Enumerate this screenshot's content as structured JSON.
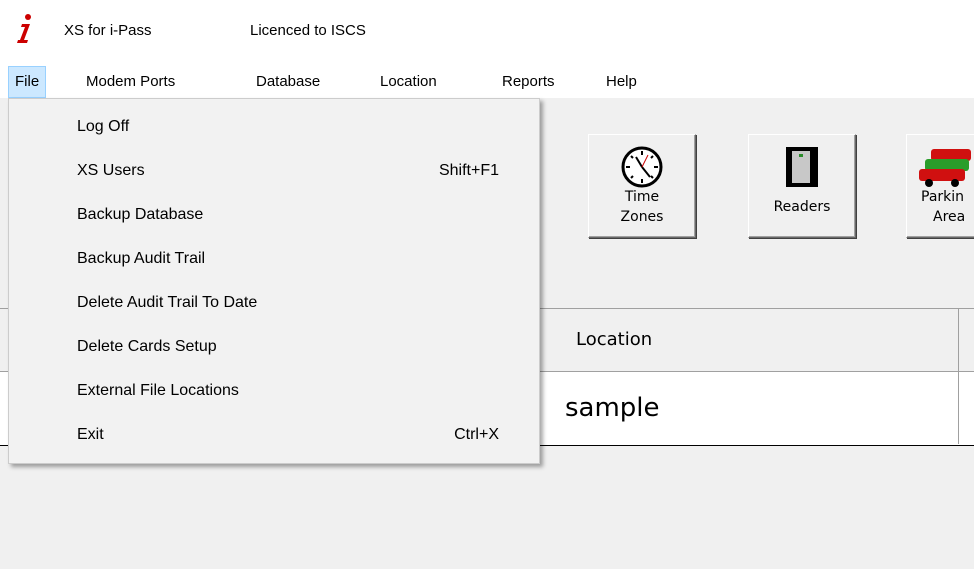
{
  "titlebar": {
    "app_name": "XS for i-Pass",
    "licence": "Licenced to ISCS",
    "icon": "italic-i-logo",
    "icon_color": "#cc0000"
  },
  "menubar": {
    "items": [
      {
        "label": "File"
      },
      {
        "label": "Modem Ports"
      },
      {
        "label": "Database"
      },
      {
        "label": "Location"
      },
      {
        "label": "Reports"
      },
      {
        "label": "Help"
      }
    ]
  },
  "file_menu": {
    "items": [
      {
        "label": "Log Off",
        "shortcut": ""
      },
      {
        "label": "XS Users",
        "shortcut": "Shift+F1"
      },
      {
        "label": "Backup Database",
        "shortcut": ""
      },
      {
        "label": "Backup Audit Trail",
        "shortcut": ""
      },
      {
        "label": "Delete Audit Trail To Date",
        "shortcut": ""
      },
      {
        "label": "Delete Cards Setup",
        "shortcut": ""
      },
      {
        "label": "External File Locations",
        "shortcut": ""
      },
      {
        "label": "Exit",
        "shortcut": "Ctrl+X"
      }
    ]
  },
  "toolbar": {
    "time_zones": {
      "label_line1": "Time",
      "label_line2": "Zones",
      "icon": "clock-icon"
    },
    "readers": {
      "label": "Readers",
      "icon": "reader-icon"
    },
    "parking": {
      "label_line1": "Parkin",
      "label_line2": "Area",
      "icon": "cars-icon"
    }
  },
  "grid": {
    "header": {
      "location": "Location"
    },
    "rows": [
      {
        "location": "sample"
      }
    ]
  }
}
